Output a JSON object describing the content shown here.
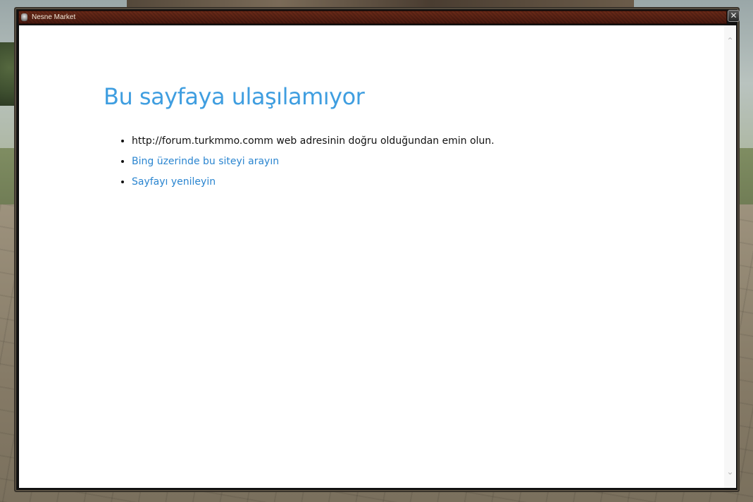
{
  "window": {
    "title": "Nesne Market",
    "close_glyph": "✕",
    "icon": "app-icon"
  },
  "page": {
    "heading": "Bu sayfaya ulaşılamıyor",
    "suggestions": [
      {
        "text": "http://forum.turkmmo.comm web adresinin doğru olduğundan emin olun."
      },
      {
        "text": "Bing üzerinde bu siteyi arayın"
      },
      {
        "text": "Sayfayı yenileyin"
      }
    ]
  },
  "scrollbar": {
    "up_glyph": "⌃",
    "down_glyph": "⌄"
  },
  "colors": {
    "heading": "#3f9ee0",
    "link": "#2a85d0",
    "titlebar": "#5a2214"
  }
}
